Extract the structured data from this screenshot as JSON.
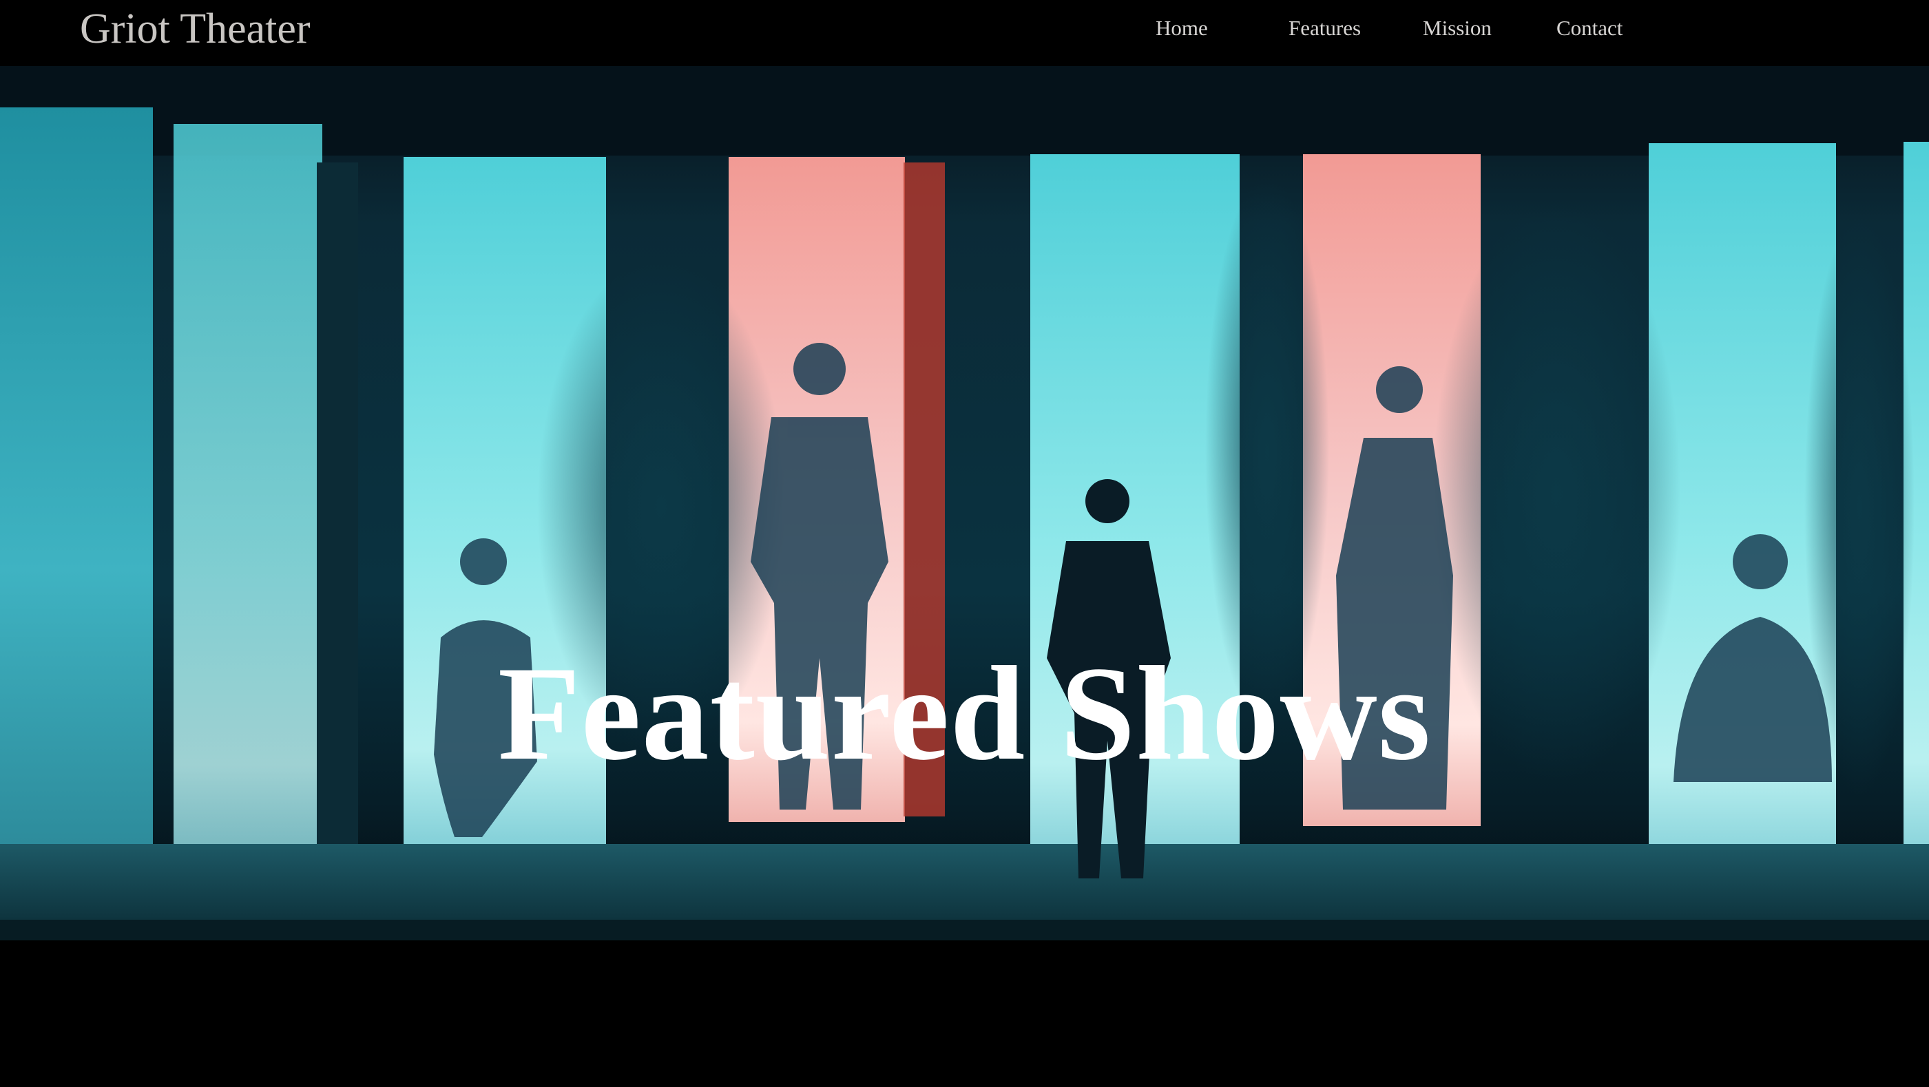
{
  "header": {
    "brand": "Griot Theater",
    "nav": [
      {
        "label": "Home"
      },
      {
        "label": "Features"
      },
      {
        "label": "Mission"
      },
      {
        "label": "Contact"
      }
    ]
  },
  "hero": {
    "title": "Featured Shows",
    "image_description_icon": "stage-silhouettes-image"
  },
  "colors": {
    "background": "#000000",
    "teal_panel": "#5fd6dc",
    "pink_panel": "#f3a3a0",
    "title_text": "#ffffff",
    "nav_text": "#d8d6d4"
  }
}
